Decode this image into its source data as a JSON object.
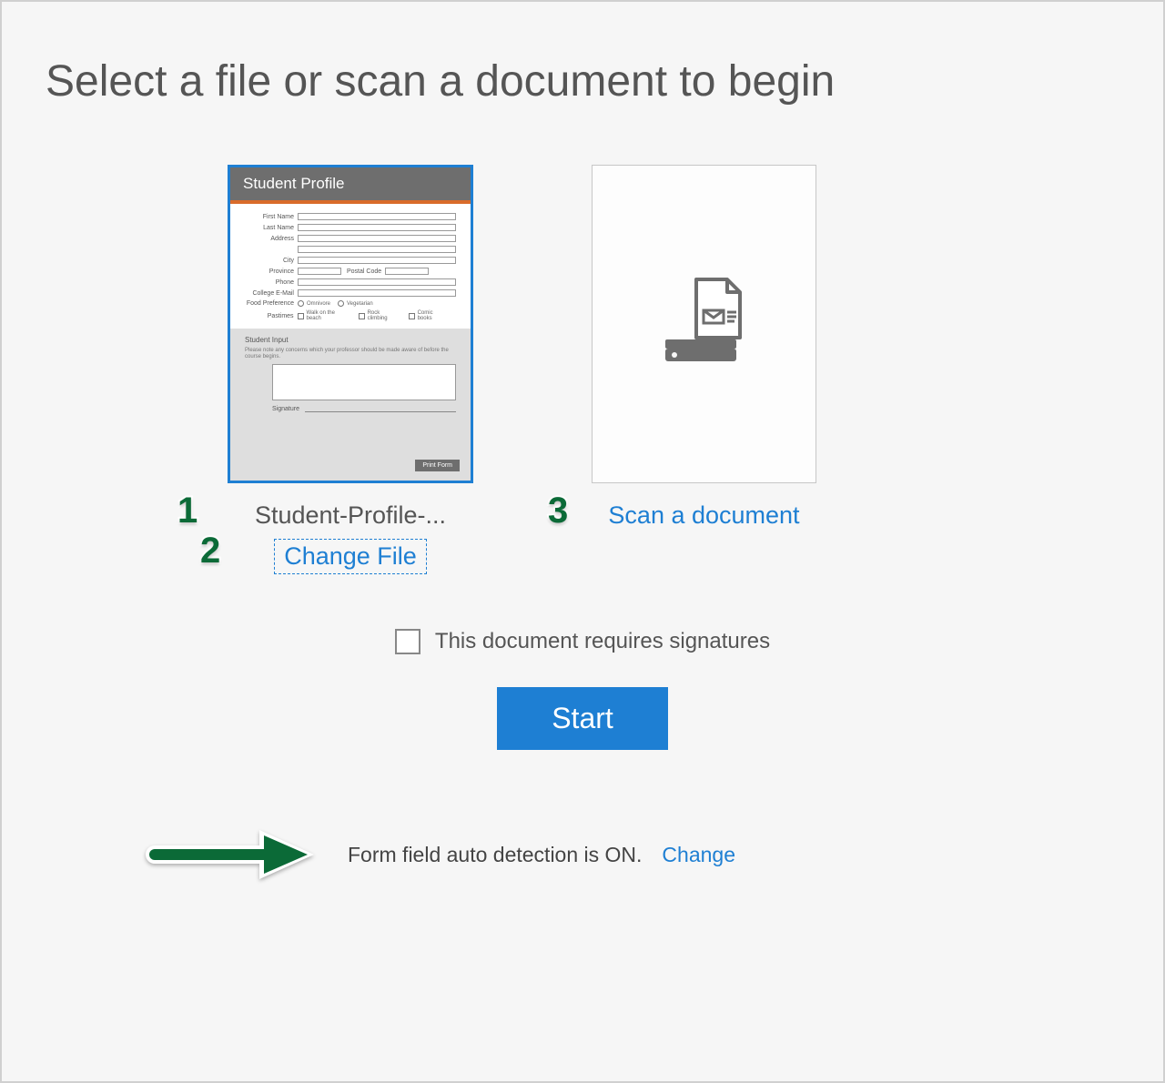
{
  "title": "Select a file or scan a document to begin",
  "file_option": {
    "thumb": {
      "header": "Student Profile",
      "fields": [
        "First Name",
        "Last Name",
        "Address",
        "City",
        "Province",
        "Postal Code",
        "Phone",
        "College E-Mail"
      ],
      "food_pref_label": "Food Preference",
      "food_pref_options": [
        "Omnivore",
        "Vegetarian"
      ],
      "pastimes_label": "Pastimes",
      "pastimes_options": [
        "Walk on the beach",
        "Rock climbing",
        "Comic books"
      ],
      "student_input_label": "Student Input",
      "student_input_desc": "Please note any concerns which your professor should be made aware of before the course begins.",
      "signature_label": "Signature",
      "print_btn": "Print Form"
    },
    "filename_display": "Student-Profile-...",
    "change_file_label": "Change File"
  },
  "scan_option": {
    "label": "Scan a document"
  },
  "signatures": {
    "label": "This document requires signatures",
    "checked": false
  },
  "start_button_label": "Start",
  "detection": {
    "status_text": "Form field auto detection is ON.",
    "change_label": "Change"
  },
  "callouts": {
    "one": "1",
    "two": "2",
    "three": "3"
  }
}
